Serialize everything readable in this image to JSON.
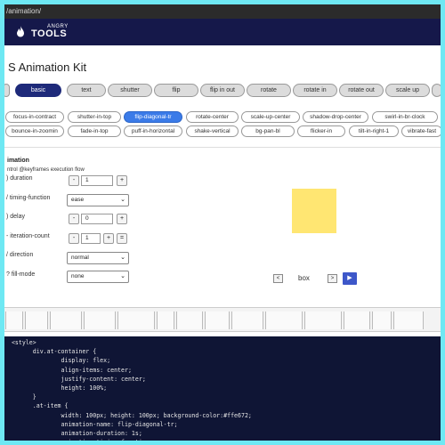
{
  "browser": {
    "url": "/animation/"
  },
  "brand": {
    "small": "ANGRY",
    "big": "TOOLS"
  },
  "page": {
    "title": "S Animation Kit"
  },
  "categories": [
    {
      "label": "basic",
      "active": true
    },
    {
      "label": "text"
    },
    {
      "label": "shutter"
    },
    {
      "label": "flip"
    },
    {
      "label": "flip in out"
    },
    {
      "label": "rotate"
    },
    {
      "label": "rotate in"
    },
    {
      "label": "rotate out"
    },
    {
      "label": "scale up"
    }
  ],
  "animations_row1": [
    "focus-in-contract",
    "shutter-in-top",
    "flip-diagonal-tr",
    "rotate-center",
    "scale-up-center",
    "shadow-drop-center",
    "swirl-in-br-clock"
  ],
  "animations_row2": [
    "bounce-in-zoomin",
    "fade-in-top",
    "puff-in-horizontal",
    "shake-vertical",
    "bg-pan-bl",
    "flicker-in",
    "tilt-in-right-1",
    "vibrate-fast"
  ],
  "active_animation": "flip-diagonal-tr",
  "section": {
    "title": "imation",
    "description": "ntrol @keyframes execution flow"
  },
  "controls": {
    "duration": {
      "label": ") duration",
      "value": "1",
      "minus": "-",
      "plus": "+"
    },
    "timing": {
      "label": "/ timing-function",
      "value": "ease"
    },
    "delay": {
      "label": ") delay",
      "value": "0",
      "minus": "-",
      "plus": "+"
    },
    "iteration": {
      "label": "- iteration-count",
      "value": "1",
      "minus": "-",
      "plus": "+",
      "infinite": "="
    },
    "direction": {
      "label": "/ direction",
      "value": "normal"
    },
    "fill": {
      "label": "? fill-mode",
      "value": "none"
    }
  },
  "preview": {
    "box_color": "#ffe672",
    "label": "box",
    "prev": "<",
    "next": ">",
    "play": "▶"
  },
  "code_lines": [
    "  <style>",
    "        div.at-container {",
    "                display: flex;",
    "                align-items: center;",
    "                justify-content: center;",
    "                height: 100%;",
    "        }",
    "        .at-item {",
    "                width: 100px; height: 100px; background-color:#ffe672;",
    "",
    "                animation-name: flip-diagonal-tr;",
    "                animation-duration: 1s;",
    "                animation-timing-function: ease;"
  ],
  "colors": {
    "navbar": "#15184a",
    "active_category": "#1e2a7a",
    "active_chip": "#3b7be8",
    "play": "#3d57c9",
    "code_bg": "#0f1535",
    "outer_bg": "#6ee8f3"
  }
}
